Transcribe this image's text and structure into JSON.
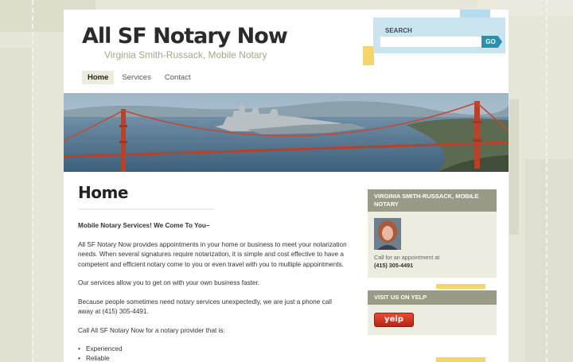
{
  "site": {
    "title": "All SF Notary Now",
    "tagline": "Virginia Smith-Russack, Mobile Notary"
  },
  "nav": {
    "items": [
      {
        "label": "Home",
        "active": true
      },
      {
        "label": "Services",
        "active": false
      },
      {
        "label": "Contact",
        "active": false
      }
    ]
  },
  "search": {
    "label": "SEARCH",
    "placeholder": "",
    "button_label": "GO"
  },
  "main": {
    "page_title": "Home",
    "lead": "Mobile Notary Services! We Come To You–",
    "paragraphs": [
      "All SF Notary Now provides appointments in your home or business to meet your notarization needs. When several signatures require notarization, it is simple and cost effective to have a competent and efficient notary come to you or even travel with you to multiple appointments.",
      "Our services allow you to get on with your own business faster.",
      "Because people sometimes need notary services unexpectedly, we are just a phone call away at (415) 305-4491.",
      "Call All SF Notary Now for a notary provider that is:"
    ],
    "list": [
      "Experienced",
      "Reliable"
    ]
  },
  "sidebar": {
    "profile_widget": {
      "title": "VIRGINIA SMITH-RUSSACK, MOBILE NOTARY",
      "text": "Call for an appointment at",
      "phone": "(415) 305-4491"
    },
    "yelp_widget": {
      "title": "VISIT US ON YELP",
      "badge_label": "yelp"
    }
  },
  "colors": {
    "background": "#e8e6d8",
    "accent_blue": "#2a8fb0",
    "search_bg": "#c9e4ef",
    "widget_title_bg": "#9b9a86",
    "widget_bg": "#edece1",
    "yellow_accent": "#f5d46a"
  }
}
